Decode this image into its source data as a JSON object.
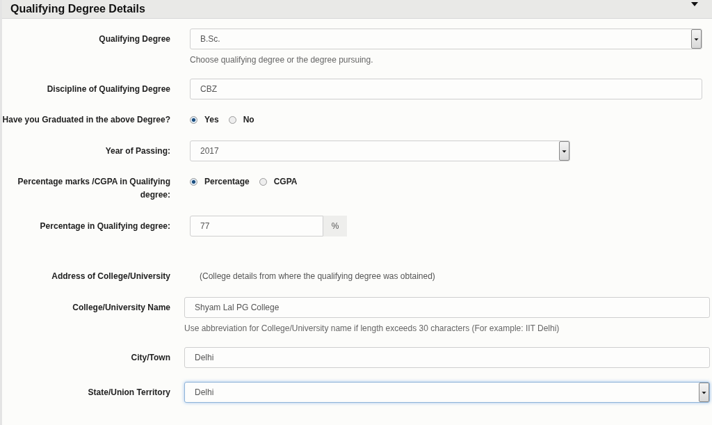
{
  "panel": {
    "title": "Qualifying Degree Details",
    "expanded": true
  },
  "rows": [
    {
      "kind": "select",
      "label": "Qualifying Degree",
      "value": "B.Sc.",
      "help": "Choose qualifying degree or the degree pursuing.",
      "focused": false
    },
    {
      "kind": "text",
      "label": "Discipline of Qualifying Degree",
      "value": "CBZ",
      "focused": false
    },
    {
      "kind": "radio",
      "label": "Have you Graduated in the above Degree?",
      "options": [
        {
          "label": "Yes",
          "selected": true
        },
        {
          "label": "No",
          "selected": false
        }
      ]
    },
    {
      "kind": "short_select",
      "label": "Year of Passing:",
      "value": "2017",
      "focused": false
    },
    {
      "kind": "radio",
      "label": "Percentage marks /CGPA in Qualifying degree:",
      "options": [
        {
          "label": "Percentage",
          "selected": true
        },
        {
          "label": "CGPA",
          "selected": false
        }
      ]
    },
    {
      "kind": "addon",
      "label": "Percentage in Qualifying degree:",
      "value": "77",
      "addon": "%",
      "focused": false
    },
    {
      "kind": "heading",
      "label": "Address of College/University",
      "note": "(College details from where the qualifying degree was obtained)"
    },
    {
      "kind": "text",
      "label": "College/University Name",
      "value": "Shyam Lal PG College",
      "help": "Use abbreviation for College/University name if length exceeds 30 characters (For example: IIT Delhi)",
      "focused": false
    },
    {
      "kind": "text",
      "label": "City/Town",
      "value": "Delhi",
      "focused": false
    },
    {
      "kind": "select",
      "label": "State/Union Territory",
      "value": "Delhi",
      "focused": true
    }
  ]
}
